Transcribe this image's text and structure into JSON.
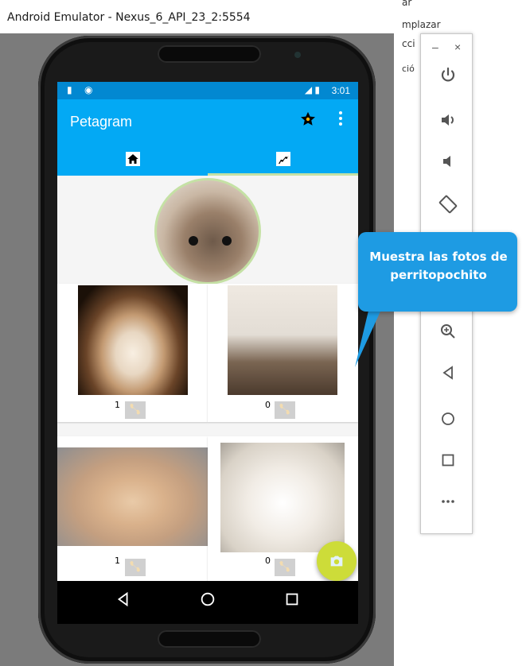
{
  "window": {
    "title": "Android Emulator - Nexus_6_API_23_2:5554"
  },
  "background_app": {
    "lines": [
      "ar",
      "mplazar",
      "cci",
      "ció"
    ]
  },
  "side_panel": {
    "minimize": "–",
    "close": "×",
    "buttons": [
      "power-icon",
      "volume-up-icon",
      "volume-down-icon",
      "rotate-icon",
      "zoom-in-icon",
      "back-icon",
      "home-icon",
      "overview-icon",
      "more-icon"
    ]
  },
  "status_bar": {
    "time": "3:01"
  },
  "app": {
    "title": "Petagram",
    "tabs": [
      "home-icon",
      "dog-icon"
    ]
  },
  "callout": {
    "text": "Muestra las fotos de perritopochito"
  },
  "photos": [
    {
      "likes": "1"
    },
    {
      "likes": "0"
    },
    {
      "likes": "1"
    },
    {
      "likes": "0"
    }
  ]
}
